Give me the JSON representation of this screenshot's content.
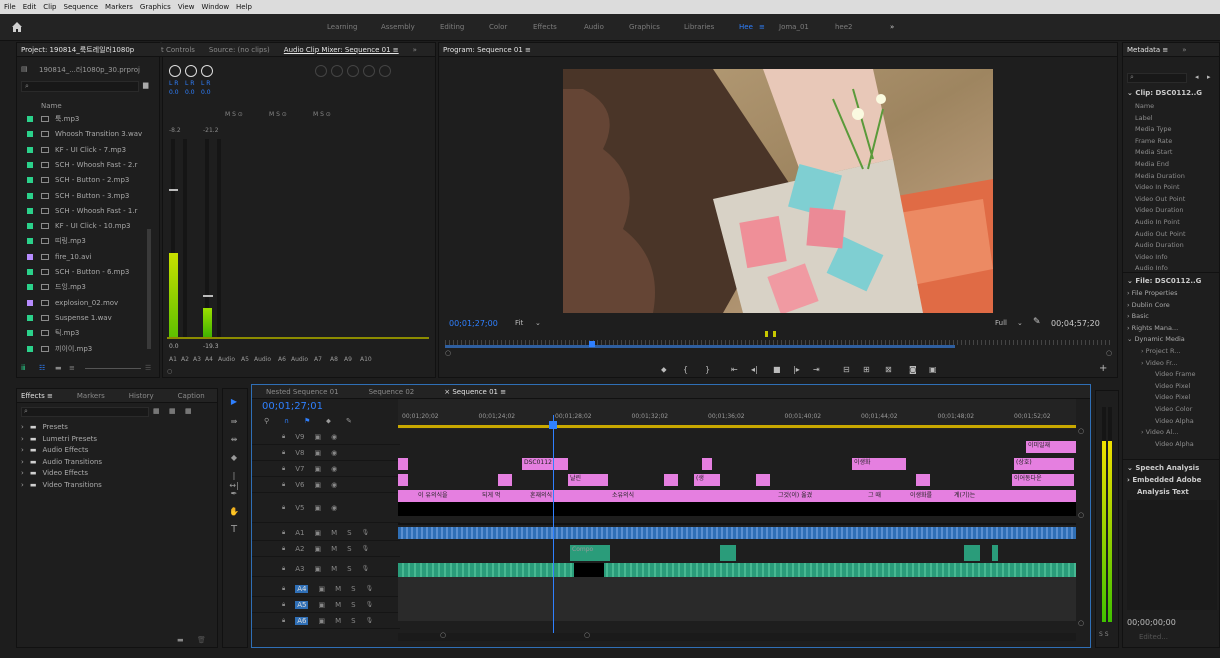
{
  "menu": [
    "File",
    "Edit",
    "Clip",
    "Sequence",
    "Markers",
    "Graphics",
    "View",
    "Window",
    "Help"
  ],
  "workspaces": {
    "items": [
      "Learning",
      "Assembly",
      "Editing",
      "Color",
      "Effects",
      "Audio",
      "Graphics",
      "Libraries",
      "Hee",
      "Joma_01",
      "hee2"
    ],
    "active": "Hee",
    "more": "»"
  },
  "project": {
    "tab_label": "Project: 190814_룩트레일러1080p",
    "file_name": "190814_...러1080p_30.prproj",
    "col_name": "Name",
    "items": [
      {
        "name": "툭.mp3",
        "color": "#2bd18b"
      },
      {
        "name": "Whoosh Transition 3.wav",
        "color": "#2bd18b"
      },
      {
        "name": "KF - UI Click - 7.mp3",
        "color": "#2bd18b"
      },
      {
        "name": "SCH - Whoosh Fast - 2.r",
        "color": "#2bd18b"
      },
      {
        "name": "SCH - Button - 2.mp3",
        "color": "#2bd18b"
      },
      {
        "name": "SCH - Button - 3.mp3",
        "color": "#2bd18b"
      },
      {
        "name": "SCH - Whoosh Fast - 1.r",
        "color": "#2bd18b"
      },
      {
        "name": "KF - UI Click - 10.mp3",
        "color": "#2bd18b"
      },
      {
        "name": "띠링.mp3",
        "color": "#2bd18b"
      },
      {
        "name": "fire_10.avi",
        "color": "#b78cff"
      },
      {
        "name": "SCH - Button - 6.mp3",
        "color": "#2bd18b"
      },
      {
        "name": "드잉.mp3",
        "color": "#2bd18b"
      },
      {
        "name": "explosion_02.mov",
        "color": "#b78cff"
      },
      {
        "name": "Suspense 1.wav",
        "color": "#2bd18b"
      },
      {
        "name": "틱.mp3",
        "color": "#2bd18b"
      },
      {
        "name": "끼이이.mp3",
        "color": "#2bd18b"
      }
    ]
  },
  "mixer": {
    "tabs": [
      "t Controls",
      "Source: (no clips)",
      "Audio Clip Mixer: Sequence 01 ≡"
    ],
    "active_tab": "Audio Clip Mixer: Sequence 01 ≡",
    "lr": [
      "L R",
      "L R",
      "L R"
    ],
    "vals": [
      "0.0",
      "0.0",
      "0.0"
    ],
    "msr": [
      "M S ⊙",
      "M S ⊙",
      "M S ⊙"
    ],
    "db": [
      "-8.2",
      "-21.2"
    ],
    "bottom_db": [
      "0.0",
      "-19.3"
    ],
    "tracks": [
      "A1",
      "A2",
      "A3",
      "A4",
      "Audio",
      "A5",
      "Audio",
      "A6",
      "Audio",
      "A7",
      "A8",
      "A9",
      "A10"
    ]
  },
  "program": {
    "tab_label": "Program: Sequence 01 ≡",
    "timecode": "00;01;27;00",
    "fit": "Fit",
    "full": "Full",
    "duration": "00;04;57;20"
  },
  "metadata": {
    "tab_label": "Metadata ≡",
    "clip_label": "Clip: DSC0112..G",
    "rows": [
      "Name",
      "Label",
      "Media Type",
      "Frame Rate",
      "Media Start",
      "Media End",
      "Media Duration",
      "Video In Point",
      "Video Out Point",
      "Video Duration",
      "Audio In Point",
      "Audio Out Point",
      "Audio Duration",
      "Video Info",
      "Audio Info"
    ],
    "file_label": "File: DSC0112..G",
    "sections": [
      "File Properties",
      "Dublin Core",
      "Basic",
      "Rights Mana...",
      "Dynamic Media"
    ],
    "dyn_rows": [
      "Project R...",
      "Video Fr...",
      "Video Frame",
      "Video Pixel",
      "Video Pixel",
      "Video Color",
      "Video Alpha",
      "Video Al...",
      "Video Alpha"
    ],
    "speech": [
      "Speech Analysis",
      "Embedded Adobe",
      "Analysis Text"
    ],
    "bottom_tc": "00;00;00;00",
    "edited": "Edited..."
  },
  "effects": {
    "tabs": [
      "Effects ≡",
      "Markers",
      "History",
      "Caption"
    ],
    "tree": [
      "Presets",
      "Lumetri Presets",
      "Audio Effects",
      "Audio Transitions",
      "Video Effects",
      "Video Transitions"
    ]
  },
  "timeline": {
    "tabs": [
      "Nested Sequence 01",
      "Sequence 02",
      "× Sequence 01 ≡"
    ],
    "timecode": "00;01;27;01",
    "ruler": [
      "00;01;20;02",
      "00;01;24;02",
      "00;01;28;02",
      "00;01;32;02",
      "00;01;36;02",
      "00;01;40;02",
      "00;01;44;02",
      "00;01;48;02",
      "00;01;52;02"
    ],
    "video_tracks": [
      "V9",
      "V8",
      "V7",
      "V6",
      "V5"
    ],
    "audio_tracks": [
      "A1",
      "A2",
      "A3",
      "A4",
      "A5",
      "A6"
    ],
    "clip_labels": {
      "dsc": "DSC0112",
      "nal": "날린",
      "saeng": "(생",
      "ihyo": "이생화",
      "sanghyo": "(상호)",
      "iyeodahwo": "이어동다운",
      "ilmae": "이미일재",
      "v5": [
        "이 유의식을",
        "되게 먹",
        "혼재의식",
        "소유의식",
        "그것(이) 옮겼",
        "그 때",
        "이생화를",
        "계(기)는"
      ],
      "compose": "Compo"
    }
  },
  "vu": {
    "scale": "S S"
  }
}
